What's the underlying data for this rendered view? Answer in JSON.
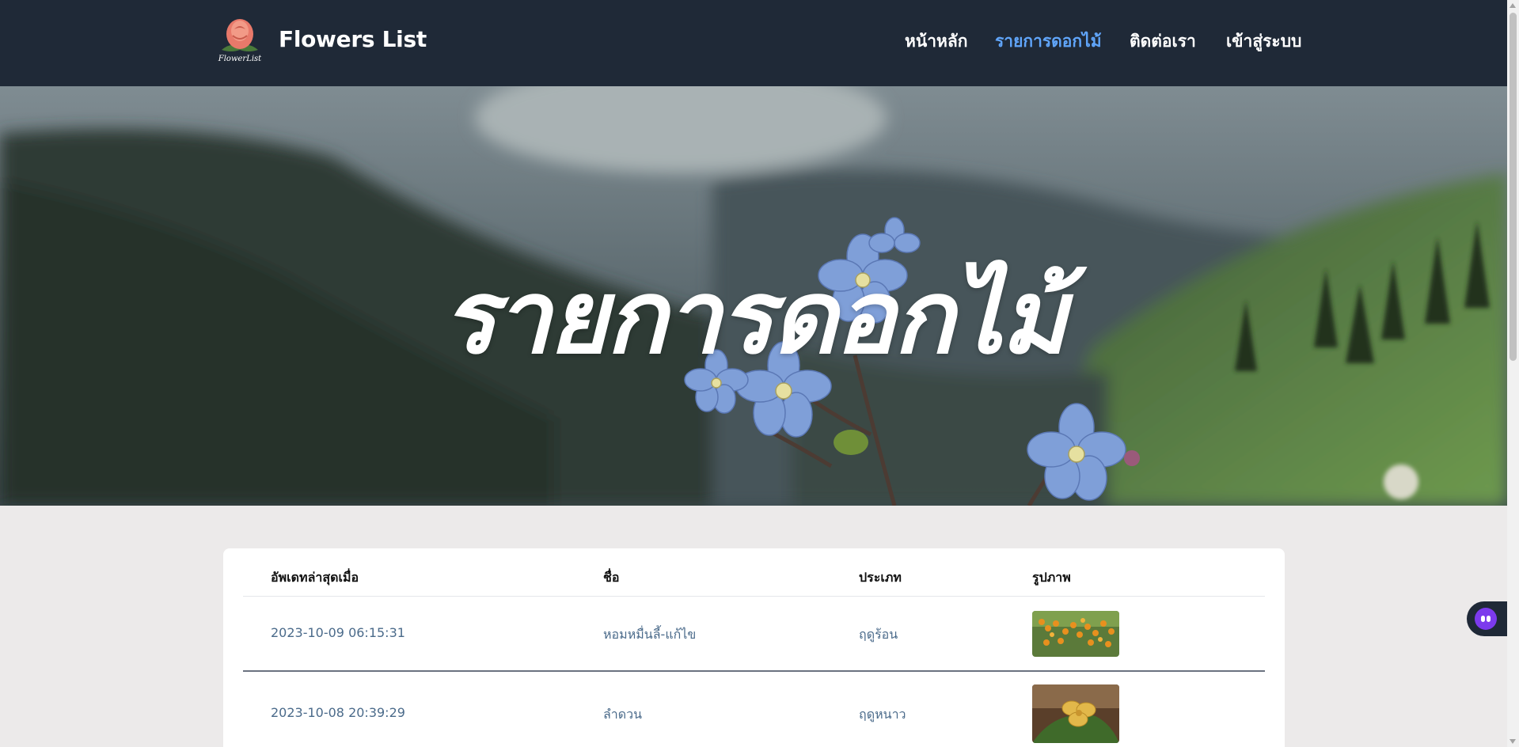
{
  "header": {
    "brand": "Flowers List",
    "logo_text": "FlowerList",
    "nav": [
      {
        "label": "หน้าหลัก",
        "active": false
      },
      {
        "label": "รายการดอกไม้",
        "active": true
      },
      {
        "label": "ติดต่อเรา",
        "active": false
      },
      {
        "label": "เข้าสู่ระบบ",
        "active": false
      }
    ]
  },
  "hero": {
    "title": "รายการดอกไม้"
  },
  "table": {
    "columns": [
      "อัพเดทล่าสุดเมื่อ",
      "ชื่อ",
      "ประเภท",
      "รูปภาพ"
    ],
    "rows": [
      {
        "updated": "2023-10-09 06:15:31",
        "name": "หอมหมื่นลี้-แก้ไข",
        "type": "ฤดูร้อน",
        "image": "orange-flower-photo"
      },
      {
        "updated": "2023-10-08 20:39:29",
        "name": "ลำดวน",
        "type": "ฤดูหนาว",
        "image": "yellow-flower-photo"
      }
    ]
  },
  "colors": {
    "header_bg": "#1f2937",
    "nav_active": "#60a5fa",
    "page_bg": "#eceaea",
    "cell_text": "#4a6a8a"
  }
}
